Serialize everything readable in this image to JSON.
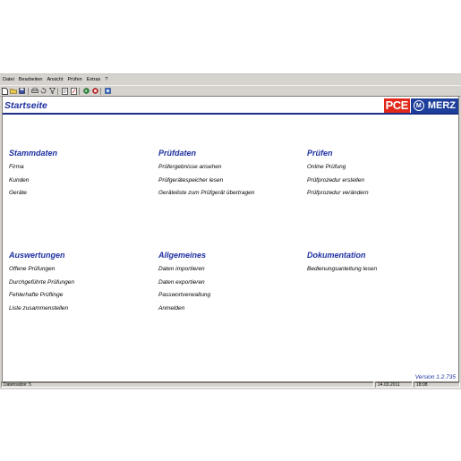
{
  "menu": [
    "Datei",
    "Bearbeiten",
    "Ansicht",
    "Prüfen",
    "Extras",
    "?"
  ],
  "toolbar": {
    "buttons": [
      "new-document-icon",
      "open-folder-icon",
      "save-icon",
      "print-icon",
      "undo-icon",
      "filter-icon",
      "report-icon",
      "edit-icon",
      "go-icon",
      "stop-icon",
      "settings-icon"
    ],
    "colors": {
      "go": "#2e8b3a",
      "stop": "#d32020"
    }
  },
  "page": {
    "title": "Startseite"
  },
  "logo": {
    "part1": "PCE",
    "part2": "M",
    "part3": "MERZ"
  },
  "sections": [
    {
      "heading": "Stammdaten",
      "links": [
        "Firma",
        "Kunden",
        "Geräte"
      ]
    },
    {
      "heading": "Prüfdaten",
      "links": [
        "Prüfergebnisse ansehen",
        "Prüfgerätespeicher lesen",
        "Geräteliste zum Prüfgerät übertragen"
      ]
    },
    {
      "heading": "Prüfen",
      "links": [
        "Online Prüfung",
        "Prüfprozedur erstellen",
        "Prüfprozedur verändern"
      ]
    },
    {
      "heading": "Auswertungen",
      "links": [
        "Offene Prüfungen",
        "Durchgeführte Prüfungen",
        "Fehlerhafte Prüflinge",
        "Liste zusammenstellen"
      ]
    },
    {
      "heading": "Allgemeines",
      "links": [
        "Daten importieren",
        "Daten exportieren",
        "Passwortverwaltung",
        "Anmelden"
      ]
    },
    {
      "heading": "Dokumentation",
      "links": [
        "Bedienungsanleitung lesen"
      ]
    }
  ],
  "version": "Version 1.2.735",
  "status": {
    "records": "Datensätze: 5",
    "date": "14.03.2011",
    "time": "18:08"
  }
}
